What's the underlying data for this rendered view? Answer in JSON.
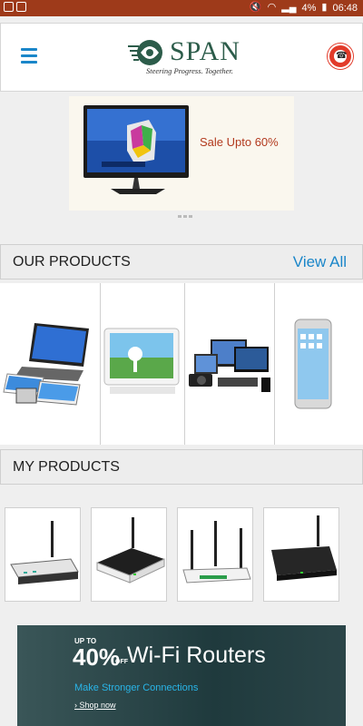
{
  "status_bar": {
    "battery": "4%",
    "time": "06:48"
  },
  "header": {
    "brand": "SPAN",
    "tagline": "Steering Progress. Together.",
    "icons": {
      "menu": "hamburger-icon",
      "emergency": "mayday-icon"
    }
  },
  "banner": {
    "promo_text": "Sale Upto 60%",
    "product_label": "Samsung SMART TV"
  },
  "our_products": {
    "title": "OUR PRODUCTS",
    "view_all": "View All",
    "items": [
      "laptops-tablets-phones",
      "tablet",
      "computers-and-cameras",
      "smartphone"
    ]
  },
  "my_products": {
    "title": "MY PRODUCTS",
    "items": [
      "wifi-router-1",
      "wifi-router-2",
      "wifi-router-3",
      "wifi-router-4"
    ]
  },
  "promo": {
    "upto": "UP TO",
    "percent": "40%",
    "off": "OFF",
    "title": "Wi-Fi Routers",
    "subtitle": "Make Stronger Connections",
    "cta": "› Shop now"
  },
  "colors": {
    "status_bar": "#9e3a1a",
    "accent": "#1a86c9",
    "sale_text": "#b23a1e",
    "promo_bg": "#2b4548"
  }
}
